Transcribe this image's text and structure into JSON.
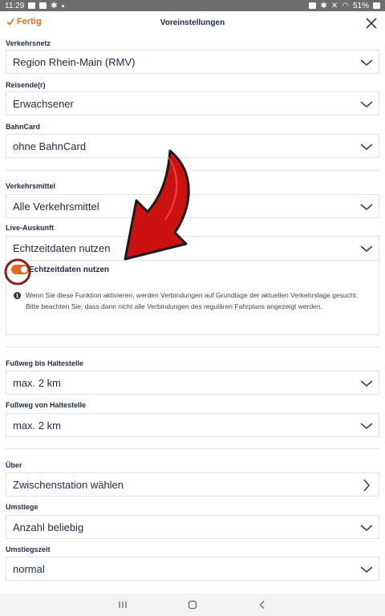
{
  "statusbar": {
    "time": "11:29",
    "battery": "51%"
  },
  "header": {
    "done_label": "Fertig",
    "title": "Voreinstellungen"
  },
  "sections": {
    "verkehrsnetz": {
      "label": "Verkehrsnetz",
      "value": "Region Rhein-Main (RMV)"
    },
    "reisende": {
      "label": "Reisende(r)",
      "value": "Erwachsener"
    },
    "bahncard": {
      "label": "BahnCard",
      "value": "ohne BahnCard"
    },
    "verkehrsmittel": {
      "label": "Verkehrsmittel",
      "value": "Alle Verkehrsmittel"
    },
    "live": {
      "label": "Live-Auskunft",
      "value": "Echtzeitdaten nutzen",
      "toggle_label": "Echtzeitdaten nutzen",
      "toggle_on": true,
      "info": "Wenn Sie diese Funktion aktivieren, werden Verbindungen auf Grundlage der aktuellen Verkehrslage gesucht. Bitte beachten Sie, dass dann nicht alle Verbindungen des regulären Fahrplans angezeigt werden."
    },
    "fussweg_bis": {
      "label": "Fußweg bis Haltestelle",
      "value": "max. 2 km"
    },
    "fussweg_von": {
      "label": "Fußweg von Haltestelle",
      "value": "max. 2 km"
    },
    "ueber": {
      "label": "Über",
      "value": "Zwischenstation wählen"
    },
    "umstiege": {
      "label": "Umstiege",
      "value": "Anzahl beliebig"
    },
    "umstiegszeit": {
      "label": "Umstiegszeit",
      "value": "normal"
    }
  },
  "colors": {
    "accent": "#e06a1b",
    "text": "#1f2a44",
    "annotation_arrow": "#cc1111"
  }
}
